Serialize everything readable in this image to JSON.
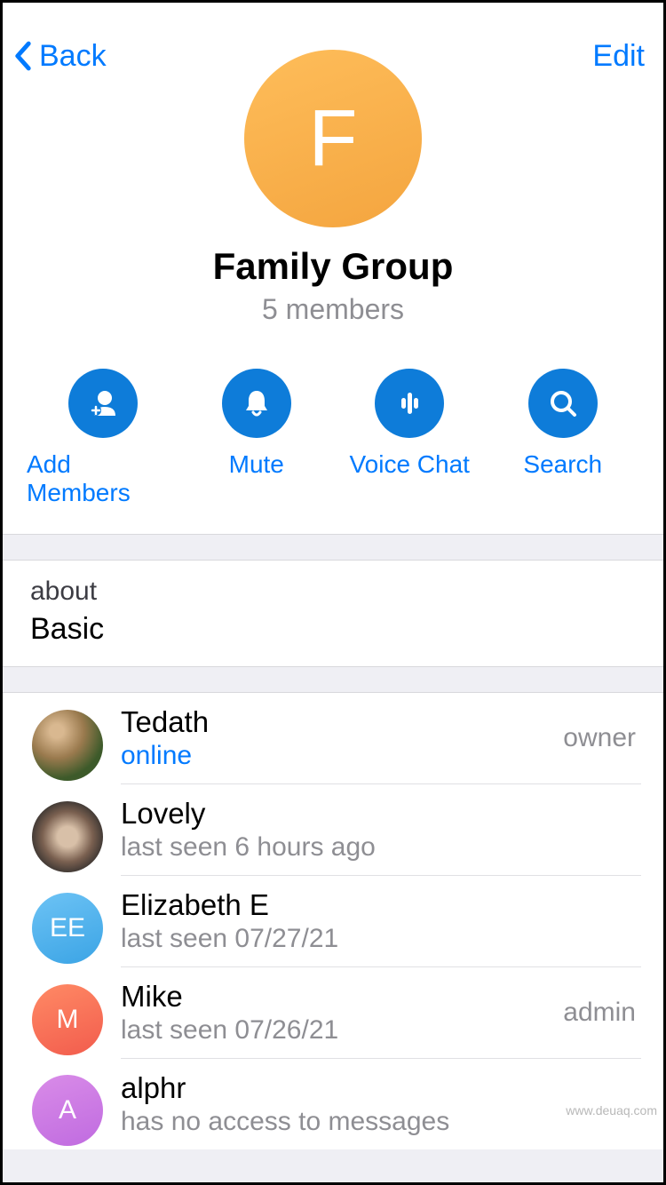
{
  "nav": {
    "back_label": "Back",
    "edit_label": "Edit"
  },
  "group": {
    "initial": "F",
    "title": "Family Group",
    "subtitle": "5 members"
  },
  "actions": {
    "add_members": "Add Members",
    "mute": "Mute",
    "voice_chat": "Voice Chat",
    "search": "Search"
  },
  "about": {
    "label": "about",
    "value": "Basic"
  },
  "members": [
    {
      "name": "Tedath",
      "status": "online",
      "status_class": "online",
      "role": "owner",
      "avatar_type": "photo",
      "avatar_text": "",
      "avatar_class": "avatar-img-1"
    },
    {
      "name": "Lovely",
      "status": "last seen 6 hours ago",
      "status_class": "",
      "role": "",
      "avatar_type": "photo",
      "avatar_text": "",
      "avatar_class": "avatar-img-2"
    },
    {
      "name": "Elizabeth E",
      "status": "last seen 07/27/21",
      "status_class": "",
      "role": "",
      "avatar_type": "initials",
      "avatar_text": "EE",
      "avatar_class": "avatar-ee"
    },
    {
      "name": "Mike",
      "status": "last seen 07/26/21",
      "status_class": "",
      "role": "admin",
      "avatar_type": "initials",
      "avatar_text": "M",
      "avatar_class": "avatar-m"
    },
    {
      "name": "alphr",
      "status": "has no access to messages",
      "status_class": "",
      "role": "",
      "avatar_type": "initials",
      "avatar_text": "A",
      "avatar_class": "avatar-a"
    }
  ],
  "watermark": "www.deuaq.com"
}
